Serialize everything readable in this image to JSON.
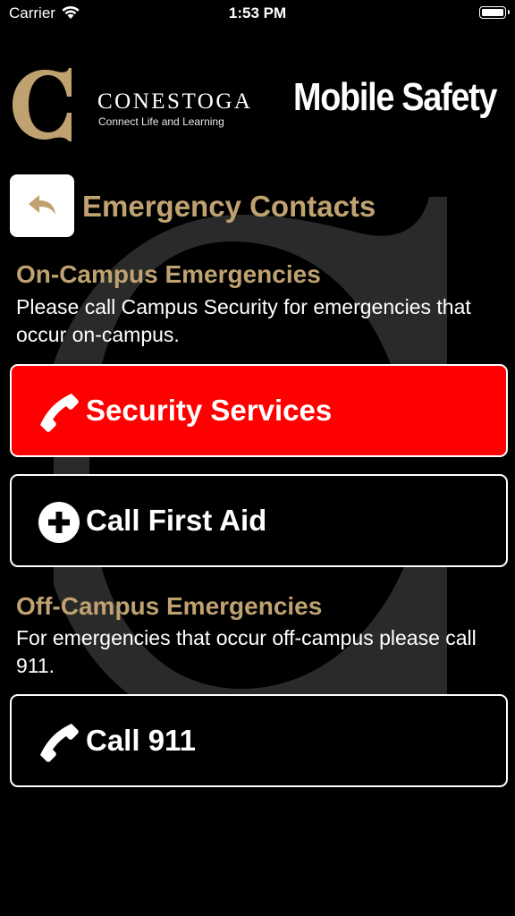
{
  "status_bar": {
    "carrier": "Carrier",
    "time": "1:53 PM"
  },
  "header": {
    "logo_name": "CONESTOGA",
    "logo_tagline": "Connect Life and Learning",
    "app_title": "Mobile Safety"
  },
  "page": {
    "title": "Emergency Contacts"
  },
  "on_campus": {
    "heading": "On-Campus Emergencies",
    "description": "Please call Campus Security for emergencies that occur on-campus."
  },
  "buttons": {
    "security": "Security Services",
    "first_aid": "Call First Aid",
    "call_911": "Call 911"
  },
  "off_campus": {
    "heading": "Off-Campus Emergencies",
    "description": "For emergencies that occur off-campus please call 911."
  },
  "colors": {
    "accent_gold": "#bfa270",
    "emergency_red": "#ff0000",
    "background": "#000000"
  },
  "icons": {
    "back": "back-arrow-icon",
    "phone": "phone-icon",
    "plus": "plus-circle-icon"
  }
}
